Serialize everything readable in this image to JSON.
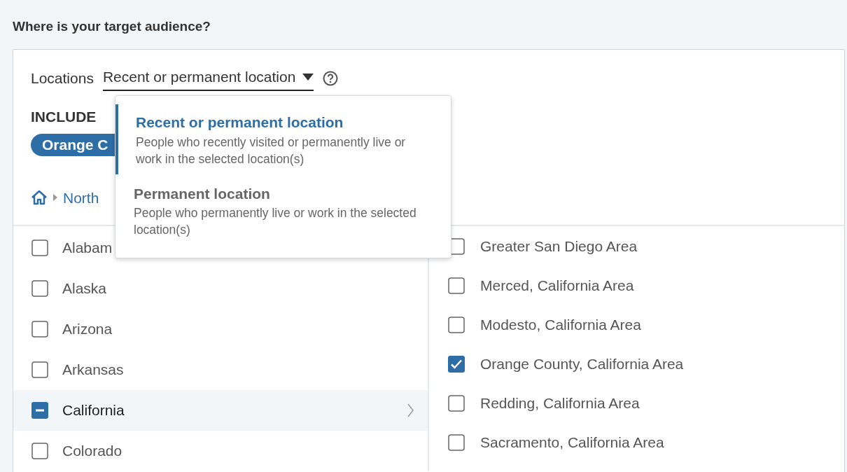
{
  "heading": "Where is your target audience?",
  "locations": {
    "label": "Locations",
    "value": "Recent or permanent location"
  },
  "include": {
    "label": "INCLUDE",
    "tags": [
      "Orange C"
    ]
  },
  "breadcrumb": [
    "North"
  ],
  "menu": [
    {
      "title": "Recent or permanent location",
      "description": "People who recently visited or permanently live or work in the selected location(s)",
      "selected": true
    },
    {
      "title": "Permanent location",
      "description": "People who permanently live or work in the selected location(s)",
      "selected": false
    }
  ],
  "states": [
    {
      "name": "Alabam",
      "checked": false,
      "partial": false,
      "selected": false
    },
    {
      "name": "Alaska",
      "checked": false,
      "partial": false,
      "selected": false
    },
    {
      "name": "Arizona",
      "checked": false,
      "partial": false,
      "selected": false
    },
    {
      "name": "Arkansas",
      "checked": false,
      "partial": false,
      "selected": false
    },
    {
      "name": "California",
      "checked": false,
      "partial": true,
      "selected": true
    },
    {
      "name": "Colorado",
      "checked": false,
      "partial": false,
      "selected": false
    }
  ],
  "areas": [
    {
      "name": "Greater San Diego Area",
      "checked": false
    },
    {
      "name": "Merced, California Area",
      "checked": false
    },
    {
      "name": "Modesto, California Area",
      "checked": false
    },
    {
      "name": "Orange County, California Area",
      "checked": true
    },
    {
      "name": "Redding, California Area",
      "checked": false
    },
    {
      "name": "Sacramento, California Area",
      "checked": false
    }
  ]
}
